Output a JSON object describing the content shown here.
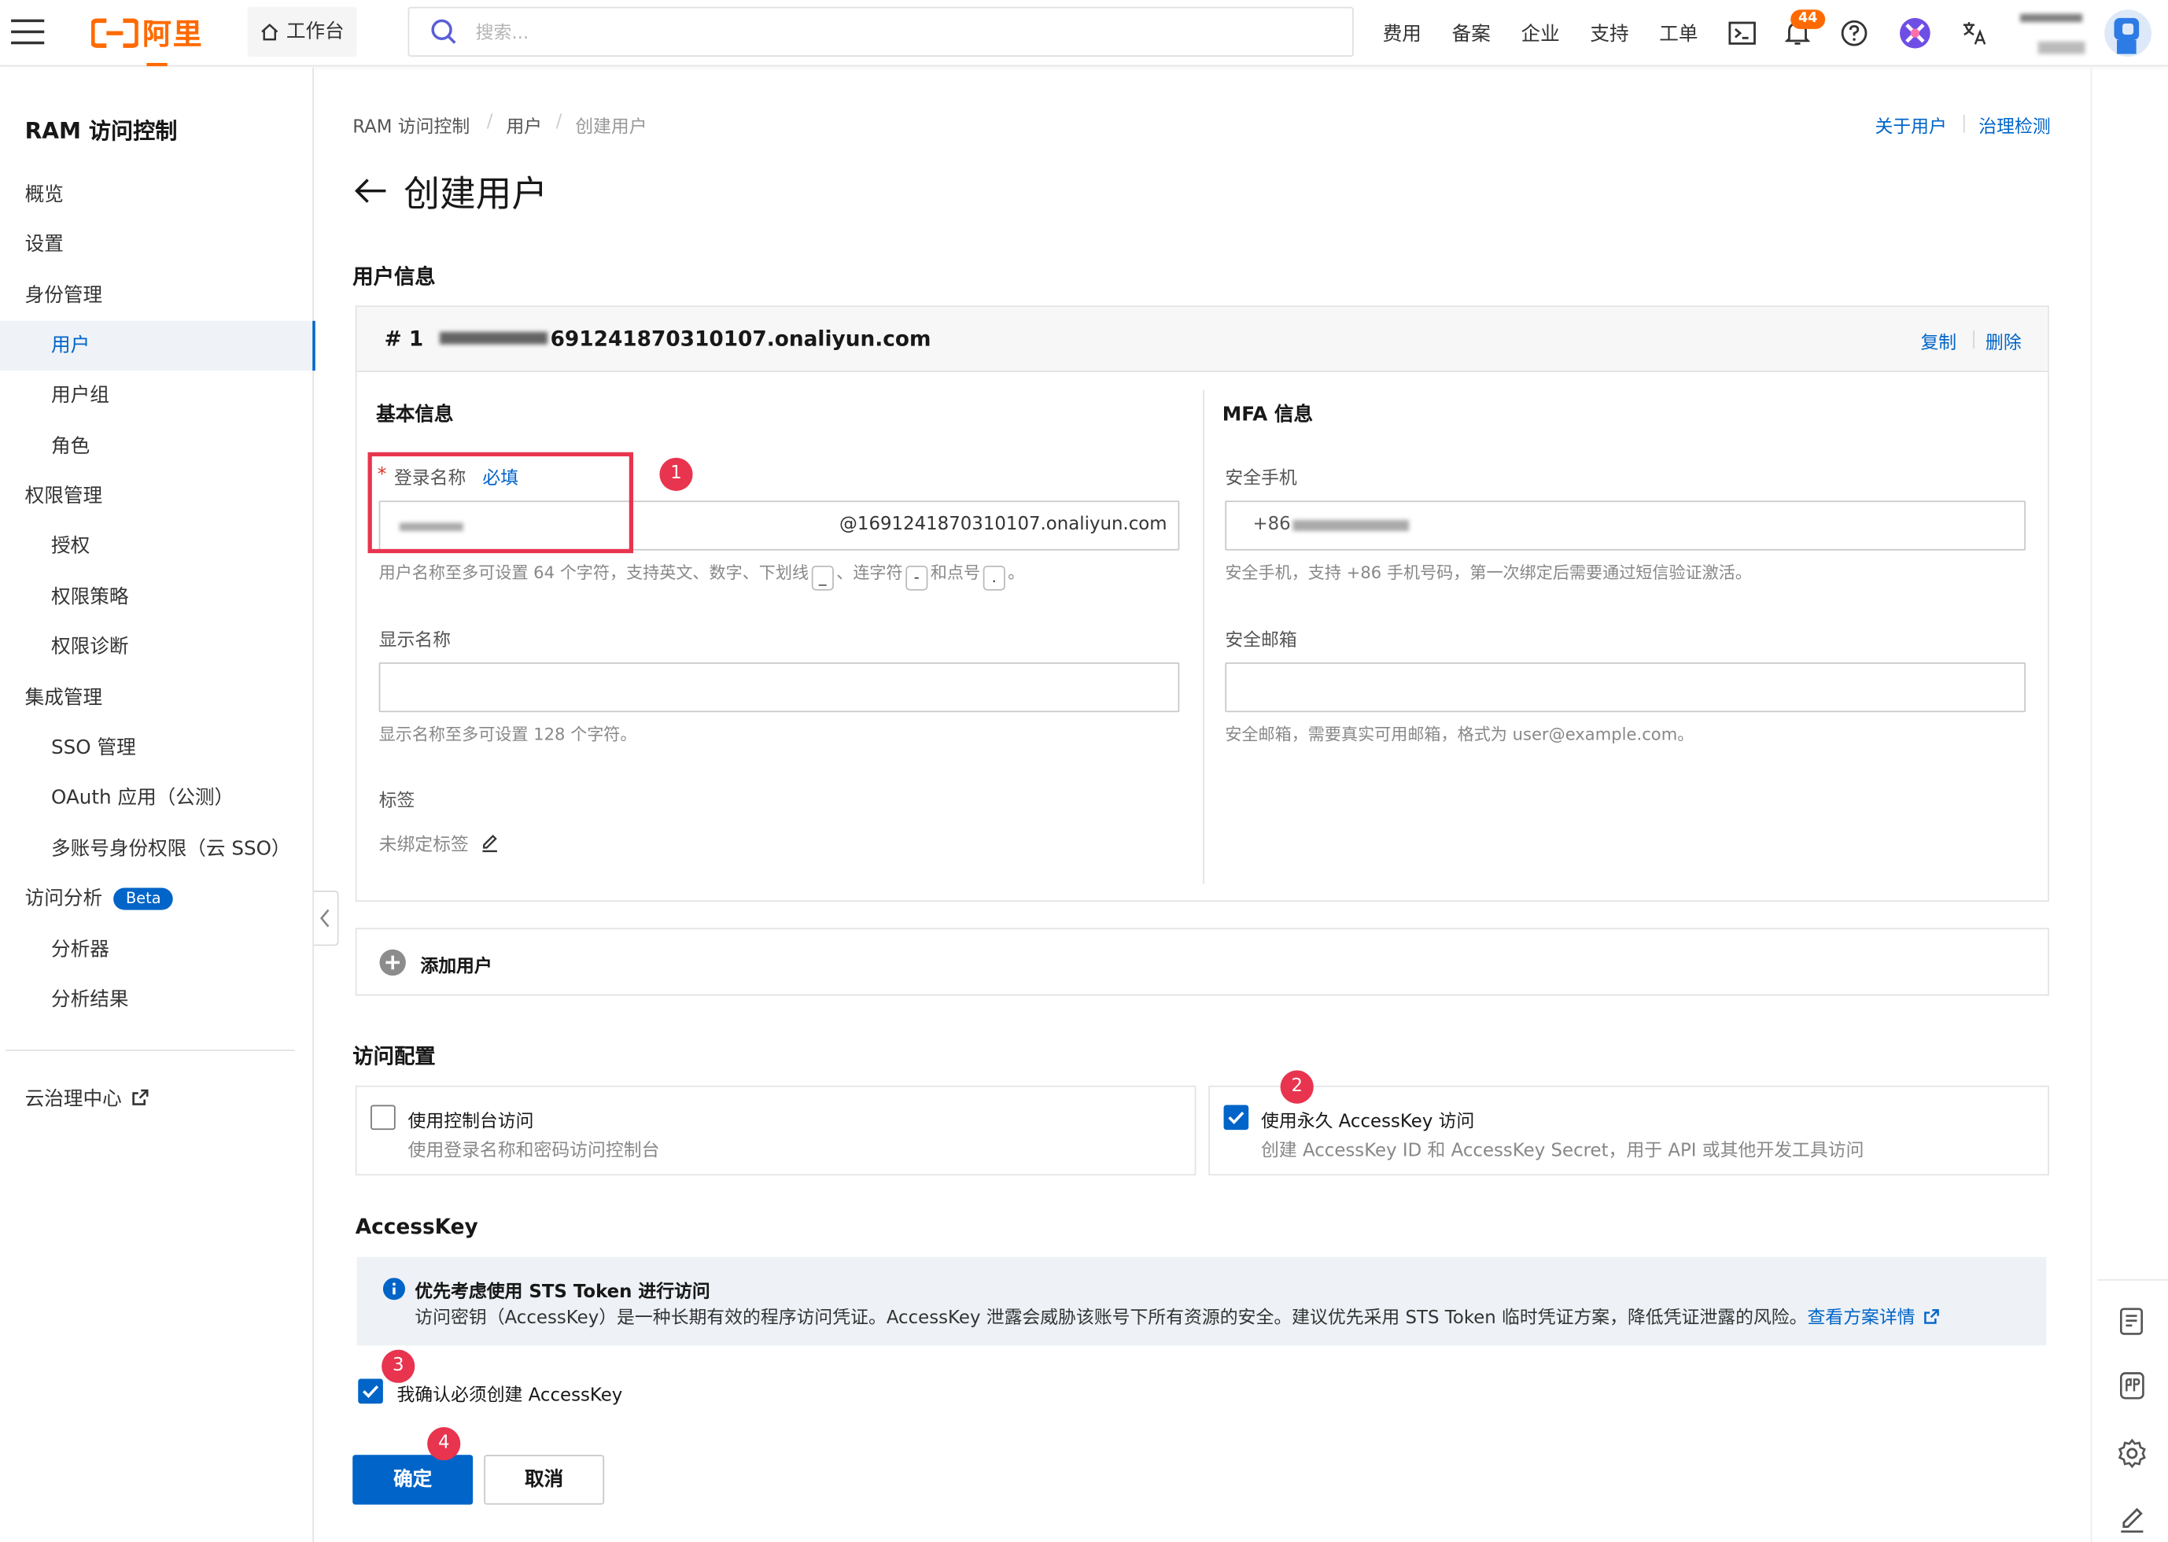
{
  "brand": {
    "logo_text": "阿里云",
    "accent": "#ff6a00",
    "primary": "#0064c8"
  },
  "topbar": {
    "workbench": "工作台",
    "search_placeholder": "搜索...",
    "nav": [
      "费用",
      "备案",
      "企业",
      "支持",
      "工单"
    ],
    "notification_count": "44"
  },
  "sidebar": {
    "title": "RAM 访问控制",
    "items": [
      {
        "label": "概览",
        "level": 1
      },
      {
        "label": "设置",
        "level": 1
      },
      {
        "label": "身份管理",
        "level": 1
      },
      {
        "label": "用户",
        "level": 2,
        "active": true
      },
      {
        "label": "用户组",
        "level": 2
      },
      {
        "label": "角色",
        "level": 2
      },
      {
        "label": "权限管理",
        "level": 1
      },
      {
        "label": "授权",
        "level": 2
      },
      {
        "label": "权限策略",
        "level": 2
      },
      {
        "label": "权限诊断",
        "level": 2
      },
      {
        "label": "集成管理",
        "level": 1
      },
      {
        "label": "SSO 管理",
        "level": 2
      },
      {
        "label": "OAuth 应用（公测）",
        "level": 2
      },
      {
        "label": "多账号身份权限（云 SSO）",
        "level": 2
      },
      {
        "label": "访问分析",
        "level": 1,
        "badge": "Beta"
      },
      {
        "label": "分析器",
        "level": 2
      },
      {
        "label": "分析结果",
        "level": 2
      }
    ],
    "footer_link": "云治理中心"
  },
  "breadcrumb": [
    "RAM 访问控制",
    "用户",
    "创建用户"
  ],
  "header_links": {
    "about": "关于用户",
    "governance": "治理检测"
  },
  "page_title": "创建用户",
  "user_info": {
    "section_title": "用户信息",
    "row_index": "# 1",
    "user_email_suffix": "691241870310107.onaliyun.com",
    "actions": {
      "copy": "复制",
      "delete": "删除"
    },
    "basic": {
      "title": "基本信息",
      "login_name_label": "登录名称",
      "required_star": "*",
      "required_tag": "必填",
      "login_domain": "@1691241870310107.onaliyun.com",
      "login_hint_prefix": "用户名称至多可设置 64 个字符，支持英文、数字、下划线",
      "login_hint_k1": "_",
      "login_hint_mid1": "、连字符",
      "login_hint_k2": "-",
      "login_hint_mid2": "和点号",
      "login_hint_k3": ".",
      "login_hint_end": "。",
      "display_name_label": "显示名称",
      "display_name_value": "",
      "display_name_hint": "显示名称至多可设置 128 个字符。",
      "tags_label": "标签",
      "tags_value": "未绑定标签"
    },
    "mfa": {
      "title": "MFA 信息",
      "phone_label": "安全手机",
      "phone_prefix": "+86",
      "phone_hint": "安全手机，支持 +86 手机号码，第一次绑定后需要通过短信验证激活。",
      "email_label": "安全邮箱",
      "email_value": "",
      "email_hint": "安全邮箱，需要真实可用邮箱，格式为 user@example.com。"
    },
    "add_user": "添加用户"
  },
  "access_config": {
    "title": "访问配置",
    "console": {
      "label": "使用控制台访问",
      "desc": "使用登录名称和密码访问控制台",
      "checked": false
    },
    "accesskey": {
      "label": "使用永久 AccessKey 访问",
      "desc": "创建 AccessKey ID 和 AccessKey Secret，用于 API 或其他开发工具访问",
      "checked": true
    }
  },
  "accesskey_section": {
    "title": "AccessKey",
    "notice_title": "优先考虑使用 STS Token 进行访问",
    "notice_body": "访问密钥（AccessKey）是一种长期有效的程序访问凭证。AccessKey 泄露会威胁该账号下所有资源的安全。建议优先采用 STS Token 临时凭证方案，降低凭证泄露的风险。",
    "notice_link": "查看方案详情",
    "confirm_label": "我确认必须创建 AccessKey",
    "confirm_checked": true
  },
  "buttons": {
    "ok": "确定",
    "cancel": "取消"
  },
  "annotations": [
    "1",
    "2",
    "3",
    "4"
  ]
}
